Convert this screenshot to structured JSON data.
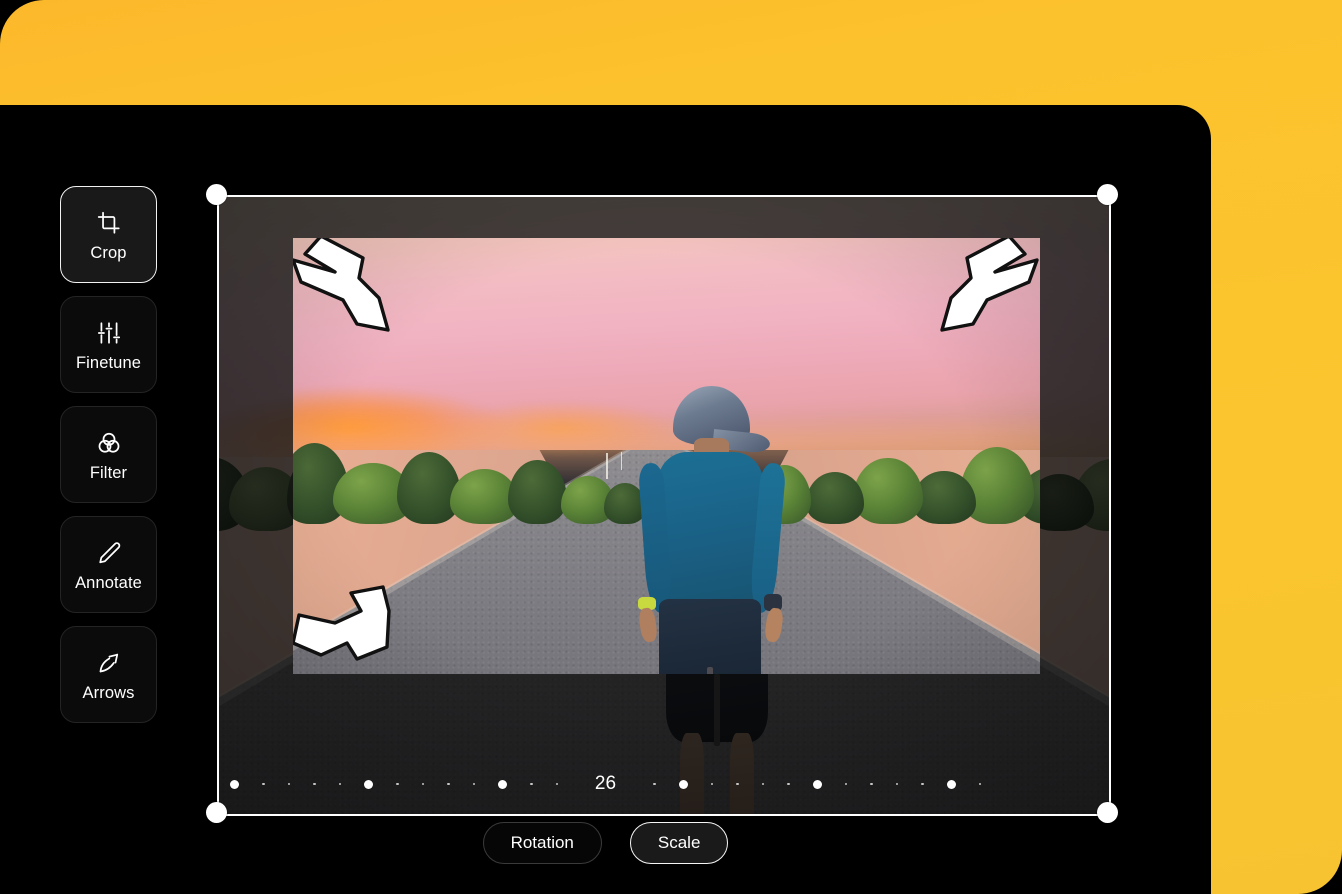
{
  "app": {
    "background_color": "#fbc52e",
    "panel_color": "#000000",
    "accent_color": "#ffffff"
  },
  "toolbar": {
    "tools": [
      {
        "id": "crop",
        "label": "Crop",
        "icon": "crop-icon",
        "active": true
      },
      {
        "id": "finetune",
        "label": "Finetune",
        "icon": "sliders-icon",
        "active": false
      },
      {
        "id": "filter",
        "label": "Filter",
        "icon": "venn-circles-icon",
        "active": false
      },
      {
        "id": "annotate",
        "label": "Annotate",
        "icon": "pencil-icon",
        "active": false
      },
      {
        "id": "arrows",
        "label": "Arrows",
        "icon": "curved-arrow-icon",
        "active": false
      }
    ]
  },
  "canvas": {
    "selection": {
      "handles": [
        "top-left",
        "top-right",
        "bottom-left",
        "bottom-right"
      ]
    },
    "photo": {
      "description": "Man walking away down an empty outback road at sunset",
      "annotations": [
        {
          "id": "arrow-top-left",
          "type": "hand-drawn-arrow",
          "direction": "down-right"
        },
        {
          "id": "arrow-top-right",
          "type": "hand-drawn-arrow",
          "direction": "down-left"
        },
        {
          "id": "arrow-bottom-left",
          "type": "hand-drawn-arrow",
          "direction": "up-right"
        }
      ]
    }
  },
  "ruler": {
    "value": "26",
    "left_dots": [
      "major",
      "tiny",
      "tiny",
      "tiny",
      "tiny",
      "major",
      "tiny",
      "tiny",
      "tiny",
      "tiny",
      "major",
      "tiny",
      "tiny"
    ],
    "right_dots": [
      "tiny",
      "major",
      "tiny",
      "tiny",
      "tiny",
      "tiny",
      "major",
      "tiny",
      "tiny",
      "tiny",
      "tiny",
      "major",
      "tiny"
    ]
  },
  "modes": {
    "items": [
      {
        "id": "rotation",
        "label": "Rotation",
        "active": false
      },
      {
        "id": "scale",
        "label": "Scale",
        "active": true
      }
    ]
  }
}
